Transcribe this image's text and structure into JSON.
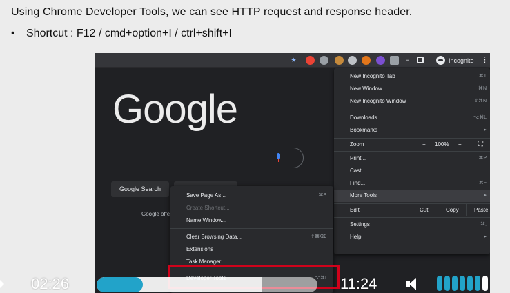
{
  "slide": {
    "line1": "Using Chrome Developer Tools, we can see HTTP request and response header.",
    "bullet": "•",
    "line2": "Shortcut : F12 / cmd+option+I / ctrl+shift+I"
  },
  "browser": {
    "incognito_label": "Incognito",
    "logo_text": "Google",
    "search_button": "Google Search",
    "offered_text": "Google offe",
    "kebab": "⋮"
  },
  "menu": {
    "items": [
      {
        "label": "New Incognito Tab",
        "shortcut": "⌘T"
      },
      {
        "label": "New Window",
        "shortcut": "⌘N"
      },
      {
        "label": "New Incognito Window",
        "shortcut": "⇧⌘N"
      },
      {
        "label": "Downloads",
        "shortcut": "⌥⌘L"
      },
      {
        "label": "Bookmarks",
        "shortcut": "▸"
      },
      {
        "label": "Zoom",
        "minus": "−",
        "value": "100%",
        "plus": "+",
        "fullscreen": "⛶"
      },
      {
        "label": "Print...",
        "shortcut": "⌘P"
      },
      {
        "label": "Cast...",
        "shortcut": ""
      },
      {
        "label": "Find...",
        "shortcut": "⌘F"
      },
      {
        "label": "More Tools",
        "shortcut": "▸"
      },
      {
        "label": "Edit",
        "cut": "Cut",
        "copy": "Copy",
        "paste": "Paste"
      },
      {
        "label": "Settings",
        "shortcut": "⌘,"
      },
      {
        "label": "Help",
        "shortcut": "▸"
      }
    ]
  },
  "submenu": {
    "items": [
      {
        "label": "Save Page As...",
        "shortcut": "⌘S"
      },
      {
        "label": "Create Shortcut...",
        "shortcut": ""
      },
      {
        "label": "Name Window...",
        "shortcut": ""
      },
      {
        "label": "Clear Browsing Data...",
        "shortcut": "⇧⌘⌫"
      },
      {
        "label": "Extensions",
        "shortcut": ""
      },
      {
        "label": "Task Manager",
        "shortcut": ""
      },
      {
        "label": "Developer Tools",
        "shortcut": "⌥⌘I"
      }
    ]
  },
  "video": {
    "current_time": "02:26",
    "total_time": "11:24",
    "progress": 0.21,
    "buffered": 0.75,
    "volume_level": 0.86,
    "accent": "#22a3c9"
  },
  "colors": {
    "highlight_box": "#d0021b"
  }
}
